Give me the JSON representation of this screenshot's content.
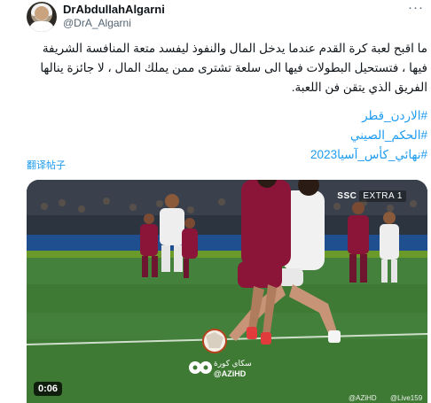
{
  "author": {
    "display_name": "DrAbdullahAlgarni",
    "handle": "@DrA_Algarni"
  },
  "tweet": {
    "text": "ما اقبح لعبة كرة القدم عندما يدخل المال والنفوذ ليفسد متعة المنافسة الشريفة فيها ، فتستحيل البطولات فيها الى سلعة تشترى ممن يملك المال ، لا جائزة ينالها الفريق الذي يتقن فن اللعبة.",
    "hashtags": [
      "#الاردن_قطر",
      "#الحكم_الصيني",
      "#نهائي_كأس_آسيا2023"
    ],
    "translate_label": "翻译帖子"
  },
  "media": {
    "broadcaster": "SSC",
    "channel": "EXTRA 1",
    "watermark_arabic": "سكاي كورة",
    "watermark_handle": "@AZiHD",
    "duration": "0:06",
    "corner_watermark_1": "@AZiHD",
    "corner_watermark_2": "@Live159"
  },
  "icons": {
    "more": "more-horizontal-icon",
    "logo": "footballs-logo-icon"
  },
  "colors": {
    "link": "#1d9bf0",
    "secondary_text": "#536471",
    "pitch": "#3f7a35",
    "qatar_kit": "#8a1538",
    "jordan_kit": "#f1f1f1"
  }
}
